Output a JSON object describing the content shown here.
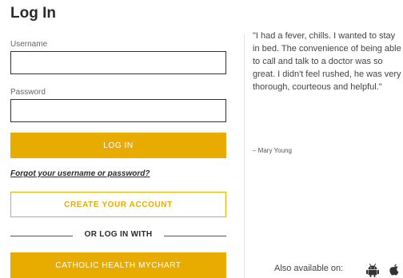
{
  "login": {
    "title": "Log In",
    "username_label": "Username",
    "username_value": "",
    "password_label": "Password",
    "password_value": "",
    "login_button": "LOG IN",
    "forgot_link": "Forgot your username or password?",
    "create_account_button": "CREATE YOUR ACCOUNT",
    "divider_text": "OR LOG IN WITH",
    "mychart_button": "CATHOLIC HEALTH MYCHART"
  },
  "testimonial": {
    "quote": "\"I had a fever, chills. I wanted to stay in bed. The convenience of being able to call and talk to a doctor was so great. I didn't feel rushed, he was very thorough, courteous and helpful.\"",
    "author": "– Mary Young"
  },
  "apps": {
    "available_text": "Also available on:",
    "icons": [
      "android-icon",
      "apple-icon"
    ]
  },
  "colors": {
    "accent": "#e8ac00",
    "text": "#2b2b2b",
    "border": "#333333"
  }
}
